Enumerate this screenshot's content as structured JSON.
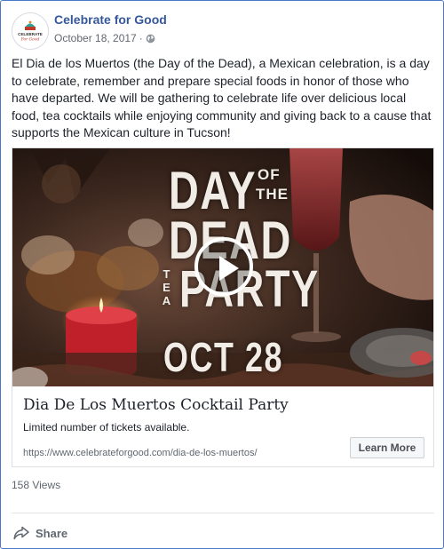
{
  "post": {
    "page_name": "Celebrate for Good",
    "date": "October 18, 2017",
    "separator": "·",
    "privacy_icon": "globe-icon",
    "avatar_text_top": "CELEBRATE",
    "avatar_text_bottom": "For Good",
    "body": "El Dia de los Muertos (the Day of the Dead), a Mexican celebration, is a day to celebrate, remember and prepare special foods in honor of those who have departed. We will be gathering to celebrate life over delicious local food, tea cocktails while enjoying community and giving back to a cause that supports the Mexican culture in Tucson!"
  },
  "video": {
    "title_day": "DAY",
    "title_of": "OF",
    "title_the": "THE",
    "title_dead": "DEAD",
    "title_tea": "TEA",
    "title_party": "PARTY",
    "title_date": "OCT 28",
    "play_icon": "play-icon"
  },
  "link_card": {
    "title": "Dia De Los Muertos Cocktail Party",
    "description": "Limited number of tickets available.",
    "url": "https://www.celebrateforgood.com/dia-de-los-muertos/",
    "cta_label": "Learn More"
  },
  "stats": {
    "views": "158 Views"
  },
  "actions": {
    "share_label": "Share",
    "share_icon": "share-icon"
  },
  "colors": {
    "link_blue": "#365899",
    "border_blue": "#4a78c8",
    "meta_gray": "#616770"
  }
}
